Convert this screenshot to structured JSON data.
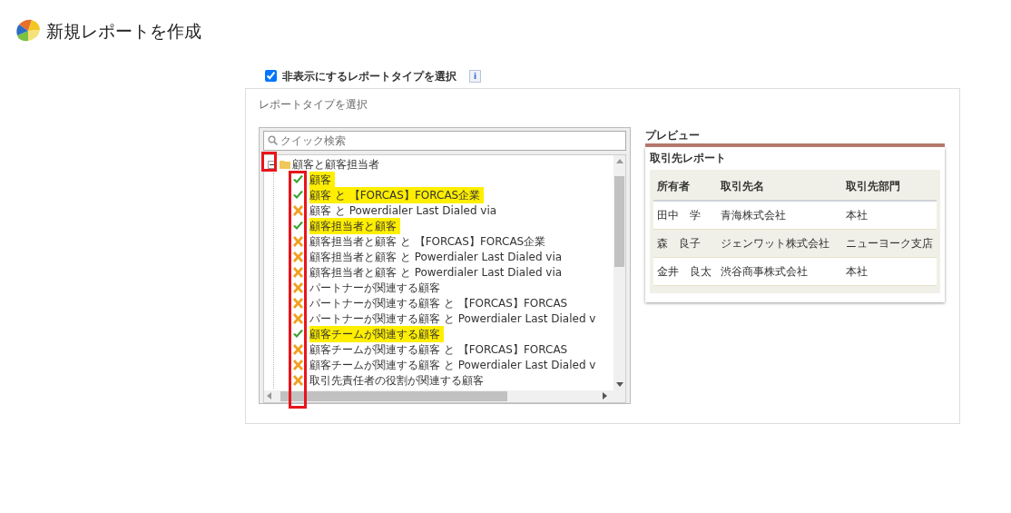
{
  "page": {
    "title": "新規レポートを作成"
  },
  "hide_option": {
    "label": "非表示にするレポートタイプを選択",
    "checked": true,
    "info": "i"
  },
  "panel": {
    "heading": "レポートタイプを選択"
  },
  "search": {
    "placeholder": "クイック検索"
  },
  "tree": {
    "label": "顧客と顧客担当者",
    "expanded": true,
    "annotated": true,
    "children": [
      {
        "label": "顧客",
        "visible": true,
        "highlighted": true
      },
      {
        "label": "顧客 と 【FORCAS】FORCAS企業",
        "visible": true,
        "highlighted": true
      },
      {
        "label": "顧客 と Powerdialer Last Dialed via",
        "visible": false,
        "highlighted": false
      },
      {
        "label": "顧客担当者と顧客",
        "visible": true,
        "highlighted": true
      },
      {
        "label": "顧客担当者と顧客 と 【FORCAS】FORCAS企業",
        "visible": false,
        "highlighted": false
      },
      {
        "label": "顧客担当者と顧客 と Powerdialer Last Dialed via",
        "visible": false,
        "highlighted": false
      },
      {
        "label": "顧客担当者と顧客 と Powerdialer Last Dialed via",
        "visible": false,
        "highlighted": false
      },
      {
        "label": "パートナーが関連する顧客",
        "visible": false,
        "highlighted": false
      },
      {
        "label": "パートナーが関連する顧客 と 【FORCAS】FORCAS",
        "visible": false,
        "highlighted": false
      },
      {
        "label": "パートナーが関連する顧客 と Powerdialer Last Dialed v",
        "visible": false,
        "highlighted": false
      },
      {
        "label": "顧客チームが関連する顧客",
        "visible": true,
        "highlighted": true
      },
      {
        "label": "顧客チームが関連する顧客 と 【FORCAS】FORCAS",
        "visible": false,
        "highlighted": false
      },
      {
        "label": "顧客チームが関連する顧客 と Powerdialer Last Dialed v",
        "visible": false,
        "highlighted": false
      },
      {
        "label": "取引先責任者の役割が関連する顧客",
        "visible": false,
        "highlighted": false
      }
    ]
  },
  "preview": {
    "heading": "プレビュー",
    "report_title": "取引先レポート",
    "columns": [
      "所有者",
      "取引先名",
      "取引先部門"
    ],
    "rows": [
      [
        "田中　学",
        "青海株式会社",
        "本社"
      ],
      [
        "森　良子",
        "ジェンワット株式会社",
        "ニューヨーク支店"
      ],
      [
        "金井　良太",
        "渋谷商事株式会社",
        "本社"
      ]
    ]
  }
}
